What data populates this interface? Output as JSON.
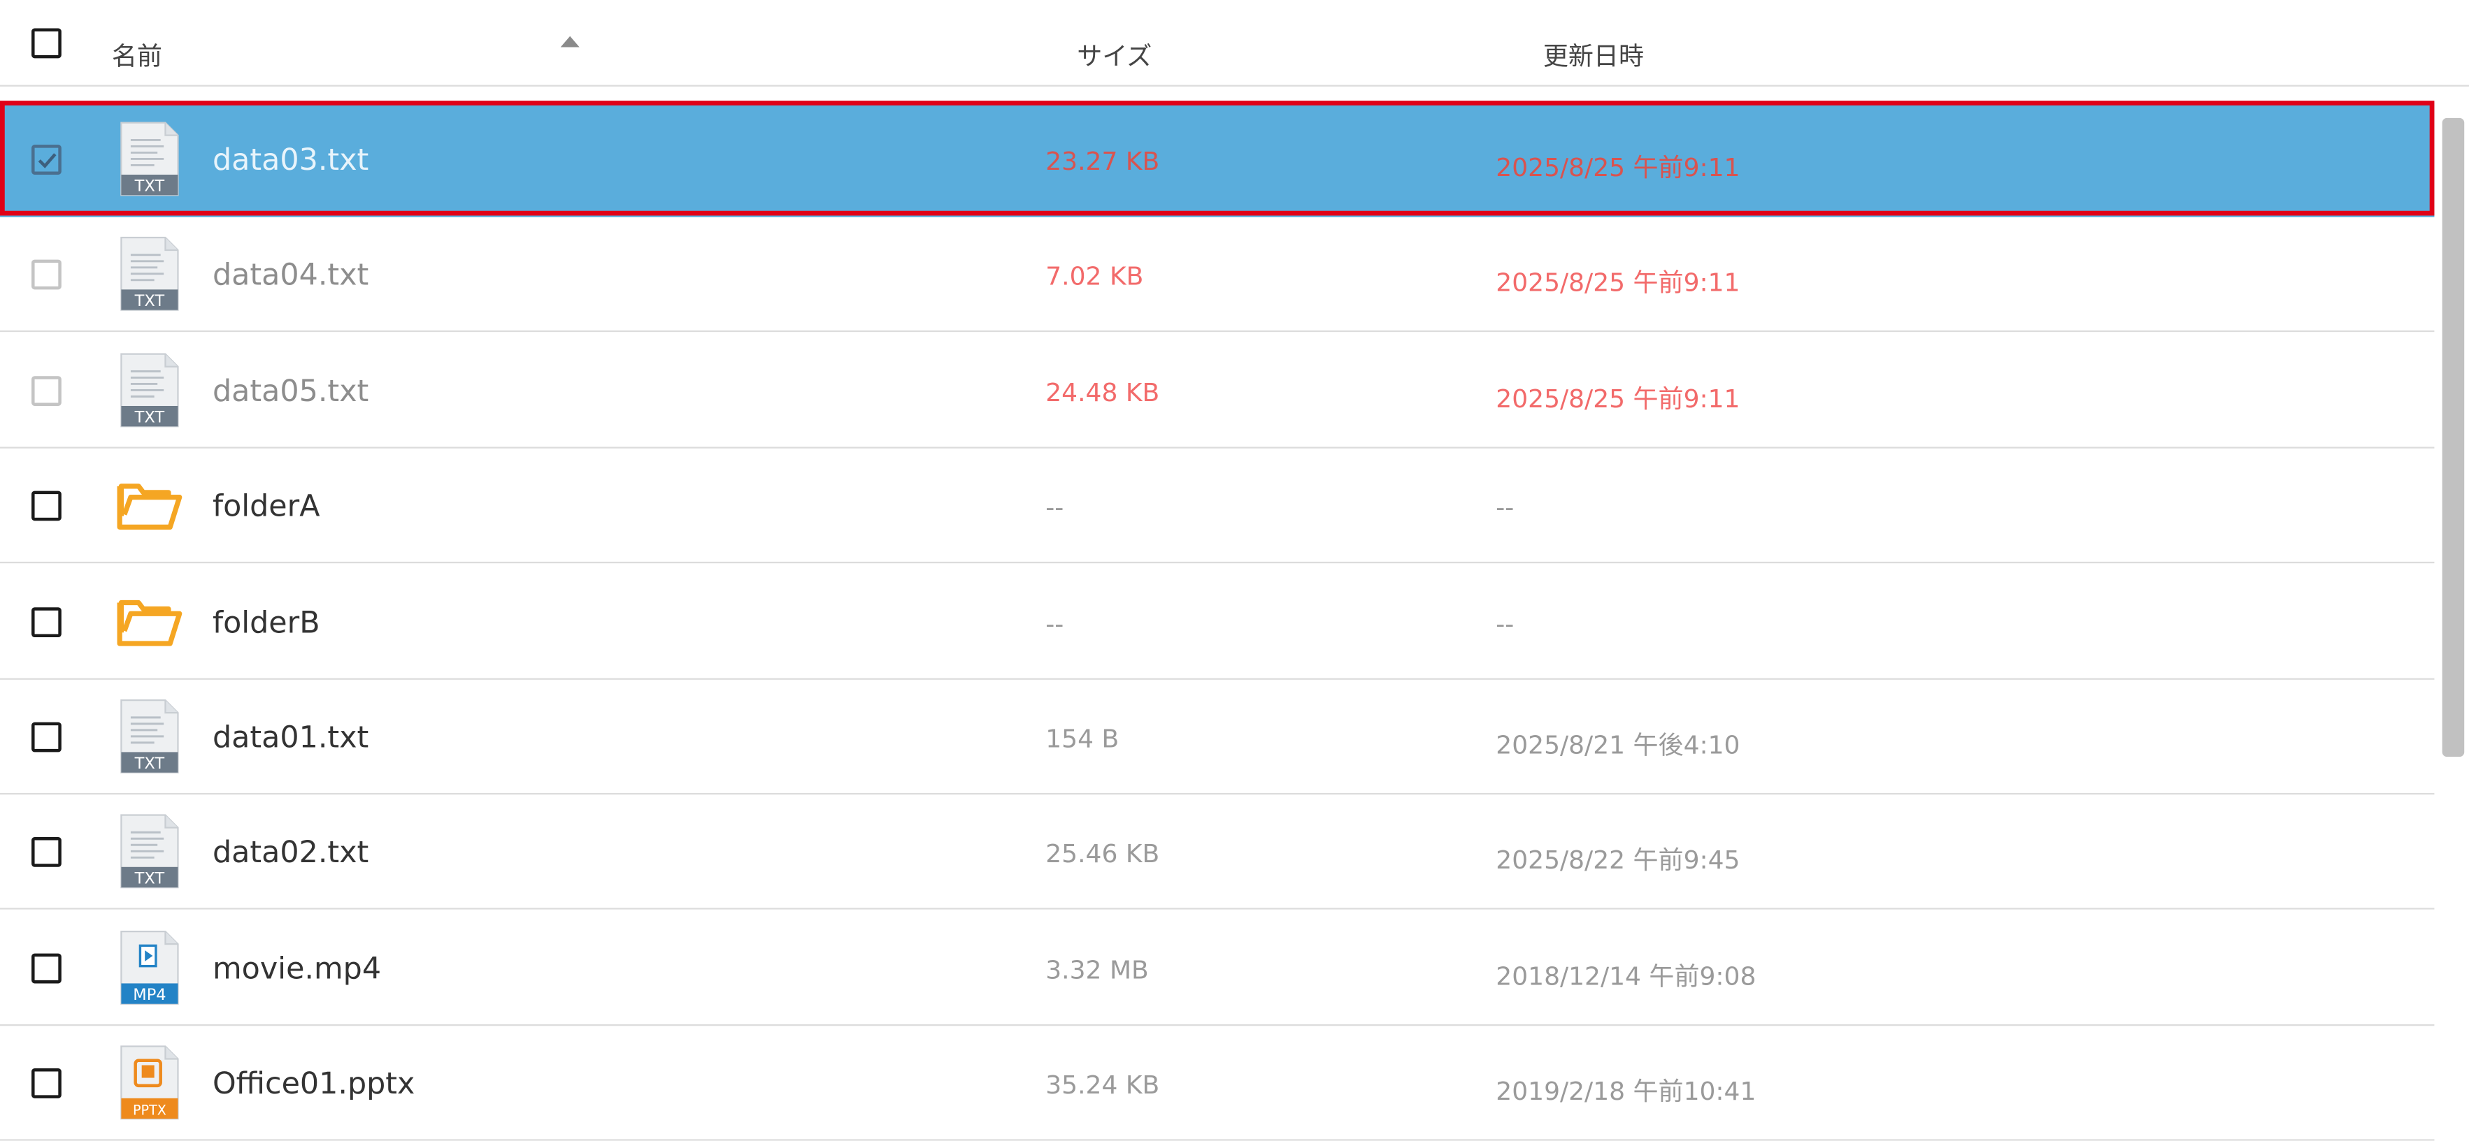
{
  "header": {
    "name_label": "名前",
    "size_label": "サイズ",
    "modified_label": "更新日時"
  },
  "rows": [
    {
      "name": "data03.txt",
      "size": "23.27 KB",
      "modified": "2025/8/25 午前9:11",
      "type": "txt",
      "icon": "txt-file-icon",
      "icon_label": "TXT",
      "checked": true
    },
    {
      "name": "data04.txt",
      "size": "7.02 KB",
      "modified": "2025/8/25 午前9:11",
      "type": "txt",
      "icon": "txt-file-icon",
      "icon_label": "TXT",
      "checked": false
    },
    {
      "name": "data05.txt",
      "size": "24.48 KB",
      "modified": "2025/8/25 午前9:11",
      "type": "txt",
      "icon": "txt-file-icon",
      "icon_label": "TXT",
      "checked": false
    },
    {
      "name": "folderA",
      "size": "--",
      "modified": "--",
      "type": "folder",
      "icon": "folder-icon",
      "checked": false
    },
    {
      "name": "folderB",
      "size": "--",
      "modified": "--",
      "type": "folder",
      "icon": "folder-icon",
      "checked": false
    },
    {
      "name": "data01.txt",
      "size": "154 B",
      "modified": "2025/8/21 午後4:10",
      "type": "txt",
      "icon": "txt-file-icon",
      "icon_label": "TXT",
      "checked": false
    },
    {
      "name": "data02.txt",
      "size": "25.46 KB",
      "modified": "2025/8/22 午前9:45",
      "type": "txt",
      "icon": "txt-file-icon",
      "icon_label": "TXT",
      "checked": false
    },
    {
      "name": "movie.mp4",
      "size": "3.32 MB",
      "modified": "2018/12/14 午前9:08",
      "type": "mp4",
      "icon": "mp4-file-icon",
      "icon_label": "MP4",
      "checked": false
    },
    {
      "name": "Office01.pptx",
      "size": "35.24 KB",
      "modified": "2019/2/18 午前10:41",
      "type": "pptx",
      "icon": "pptx-file-icon",
      "icon_label": "PPTX",
      "checked": false
    }
  ],
  "colors": {
    "selected_row_bg": "#5aaddc",
    "selection_outline": "#e00017",
    "highlight_text": "#f26a6a",
    "folder": "#f5a623",
    "txt_badge": "#6d7b89",
    "mp4_badge": "#2383c6",
    "pptx_badge": "#ee8a1d"
  }
}
